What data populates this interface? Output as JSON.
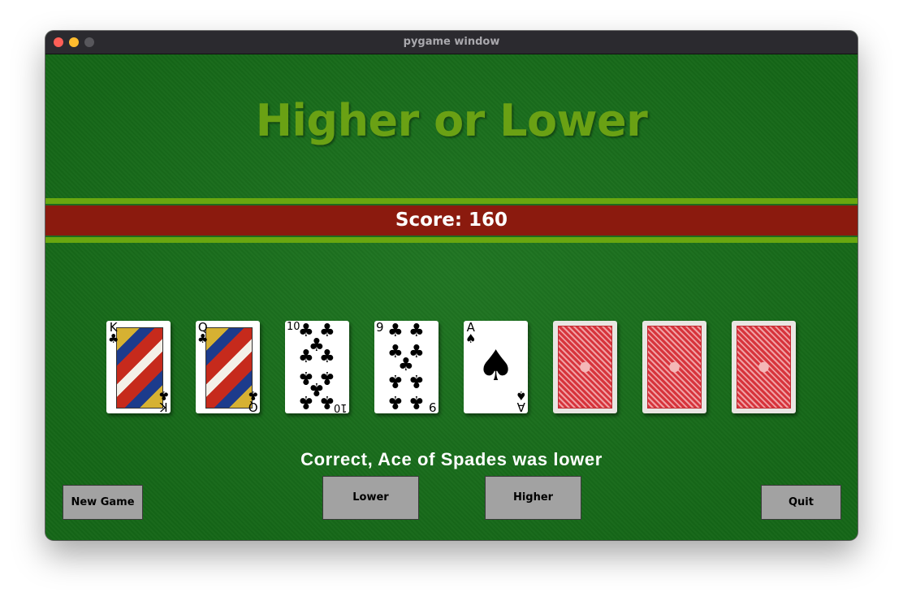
{
  "window": {
    "title": "pygame window"
  },
  "game": {
    "title": "Higher or Lower",
    "score_text": "Score: 160",
    "message": "Correct, Ace of Spades was lower"
  },
  "cards": [
    {
      "rank": "K",
      "suit": "clubs",
      "suit_symbol": "♣",
      "face_up": true
    },
    {
      "rank": "Q",
      "suit": "clubs",
      "suit_symbol": "♣",
      "face_up": true
    },
    {
      "rank": "10",
      "suit": "clubs",
      "suit_symbol": "♣",
      "face_up": true
    },
    {
      "rank": "9",
      "suit": "clubs",
      "suit_symbol": "♣",
      "face_up": true
    },
    {
      "rank": "A",
      "suit": "spades",
      "suit_symbol": "♠",
      "face_up": true
    },
    {
      "face_up": false
    },
    {
      "face_up": false
    },
    {
      "face_up": false
    }
  ],
  "buttons": {
    "new_game": "New Game",
    "lower": "Lower",
    "higher": "Higher",
    "quit": "Quit"
  },
  "colors": {
    "felt": "#17701a",
    "title": "#6aa114",
    "band_red": "#8b1a0e",
    "band_green": "#69a70f",
    "button": "#a2a2a2",
    "card_back": "#d7343c"
  }
}
